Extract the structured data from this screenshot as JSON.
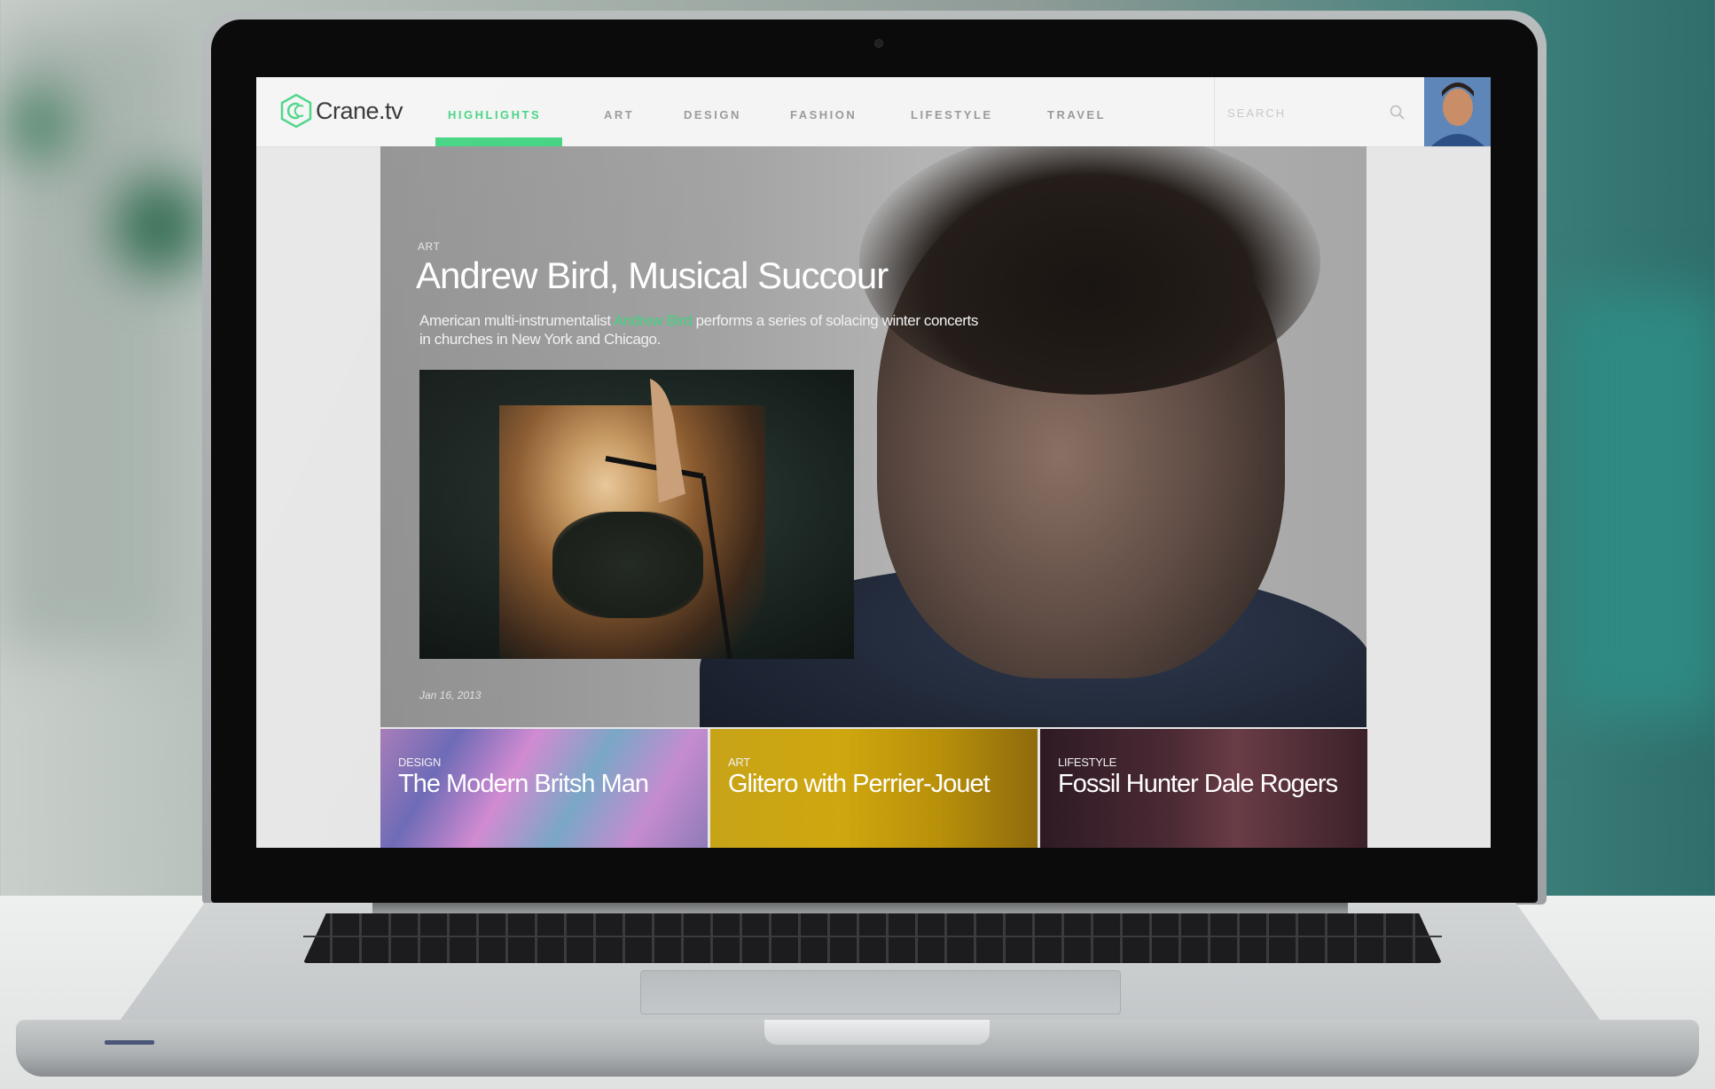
{
  "brand": {
    "name": "Crane.tv",
    "accent": "#3fd37f"
  },
  "nav": {
    "items": [
      {
        "label": "HIGHLIGHTS",
        "active": true
      },
      {
        "label": "ART",
        "active": false
      },
      {
        "label": "DESIGN",
        "active": false
      },
      {
        "label": "FASHION",
        "active": false
      },
      {
        "label": "LIFESTYLE",
        "active": false
      },
      {
        "label": "TRAVEL",
        "active": false
      }
    ]
  },
  "search": {
    "placeholder": "SEARCH",
    "icon": "search-icon"
  },
  "user": {
    "avatar": "avatar"
  },
  "hero": {
    "category": "ART",
    "title": "Andrew Bird, Musical Succour",
    "desc_before": "American multi-instrumentalist ",
    "desc_highlight": "Andrew Bird",
    "desc_after": " performs a series of solacing winter concerts in churches in New York and Chicago.",
    "date": "Jan 16, 2013"
  },
  "tiles": [
    {
      "category": "DESIGN",
      "title": "The Modern Britsh Man"
    },
    {
      "category": "ART",
      "title": "Glitero with Perrier-Jouet"
    },
    {
      "category": "LIFESTYLE",
      "title": "Fossil Hunter Dale Rogers"
    }
  ]
}
